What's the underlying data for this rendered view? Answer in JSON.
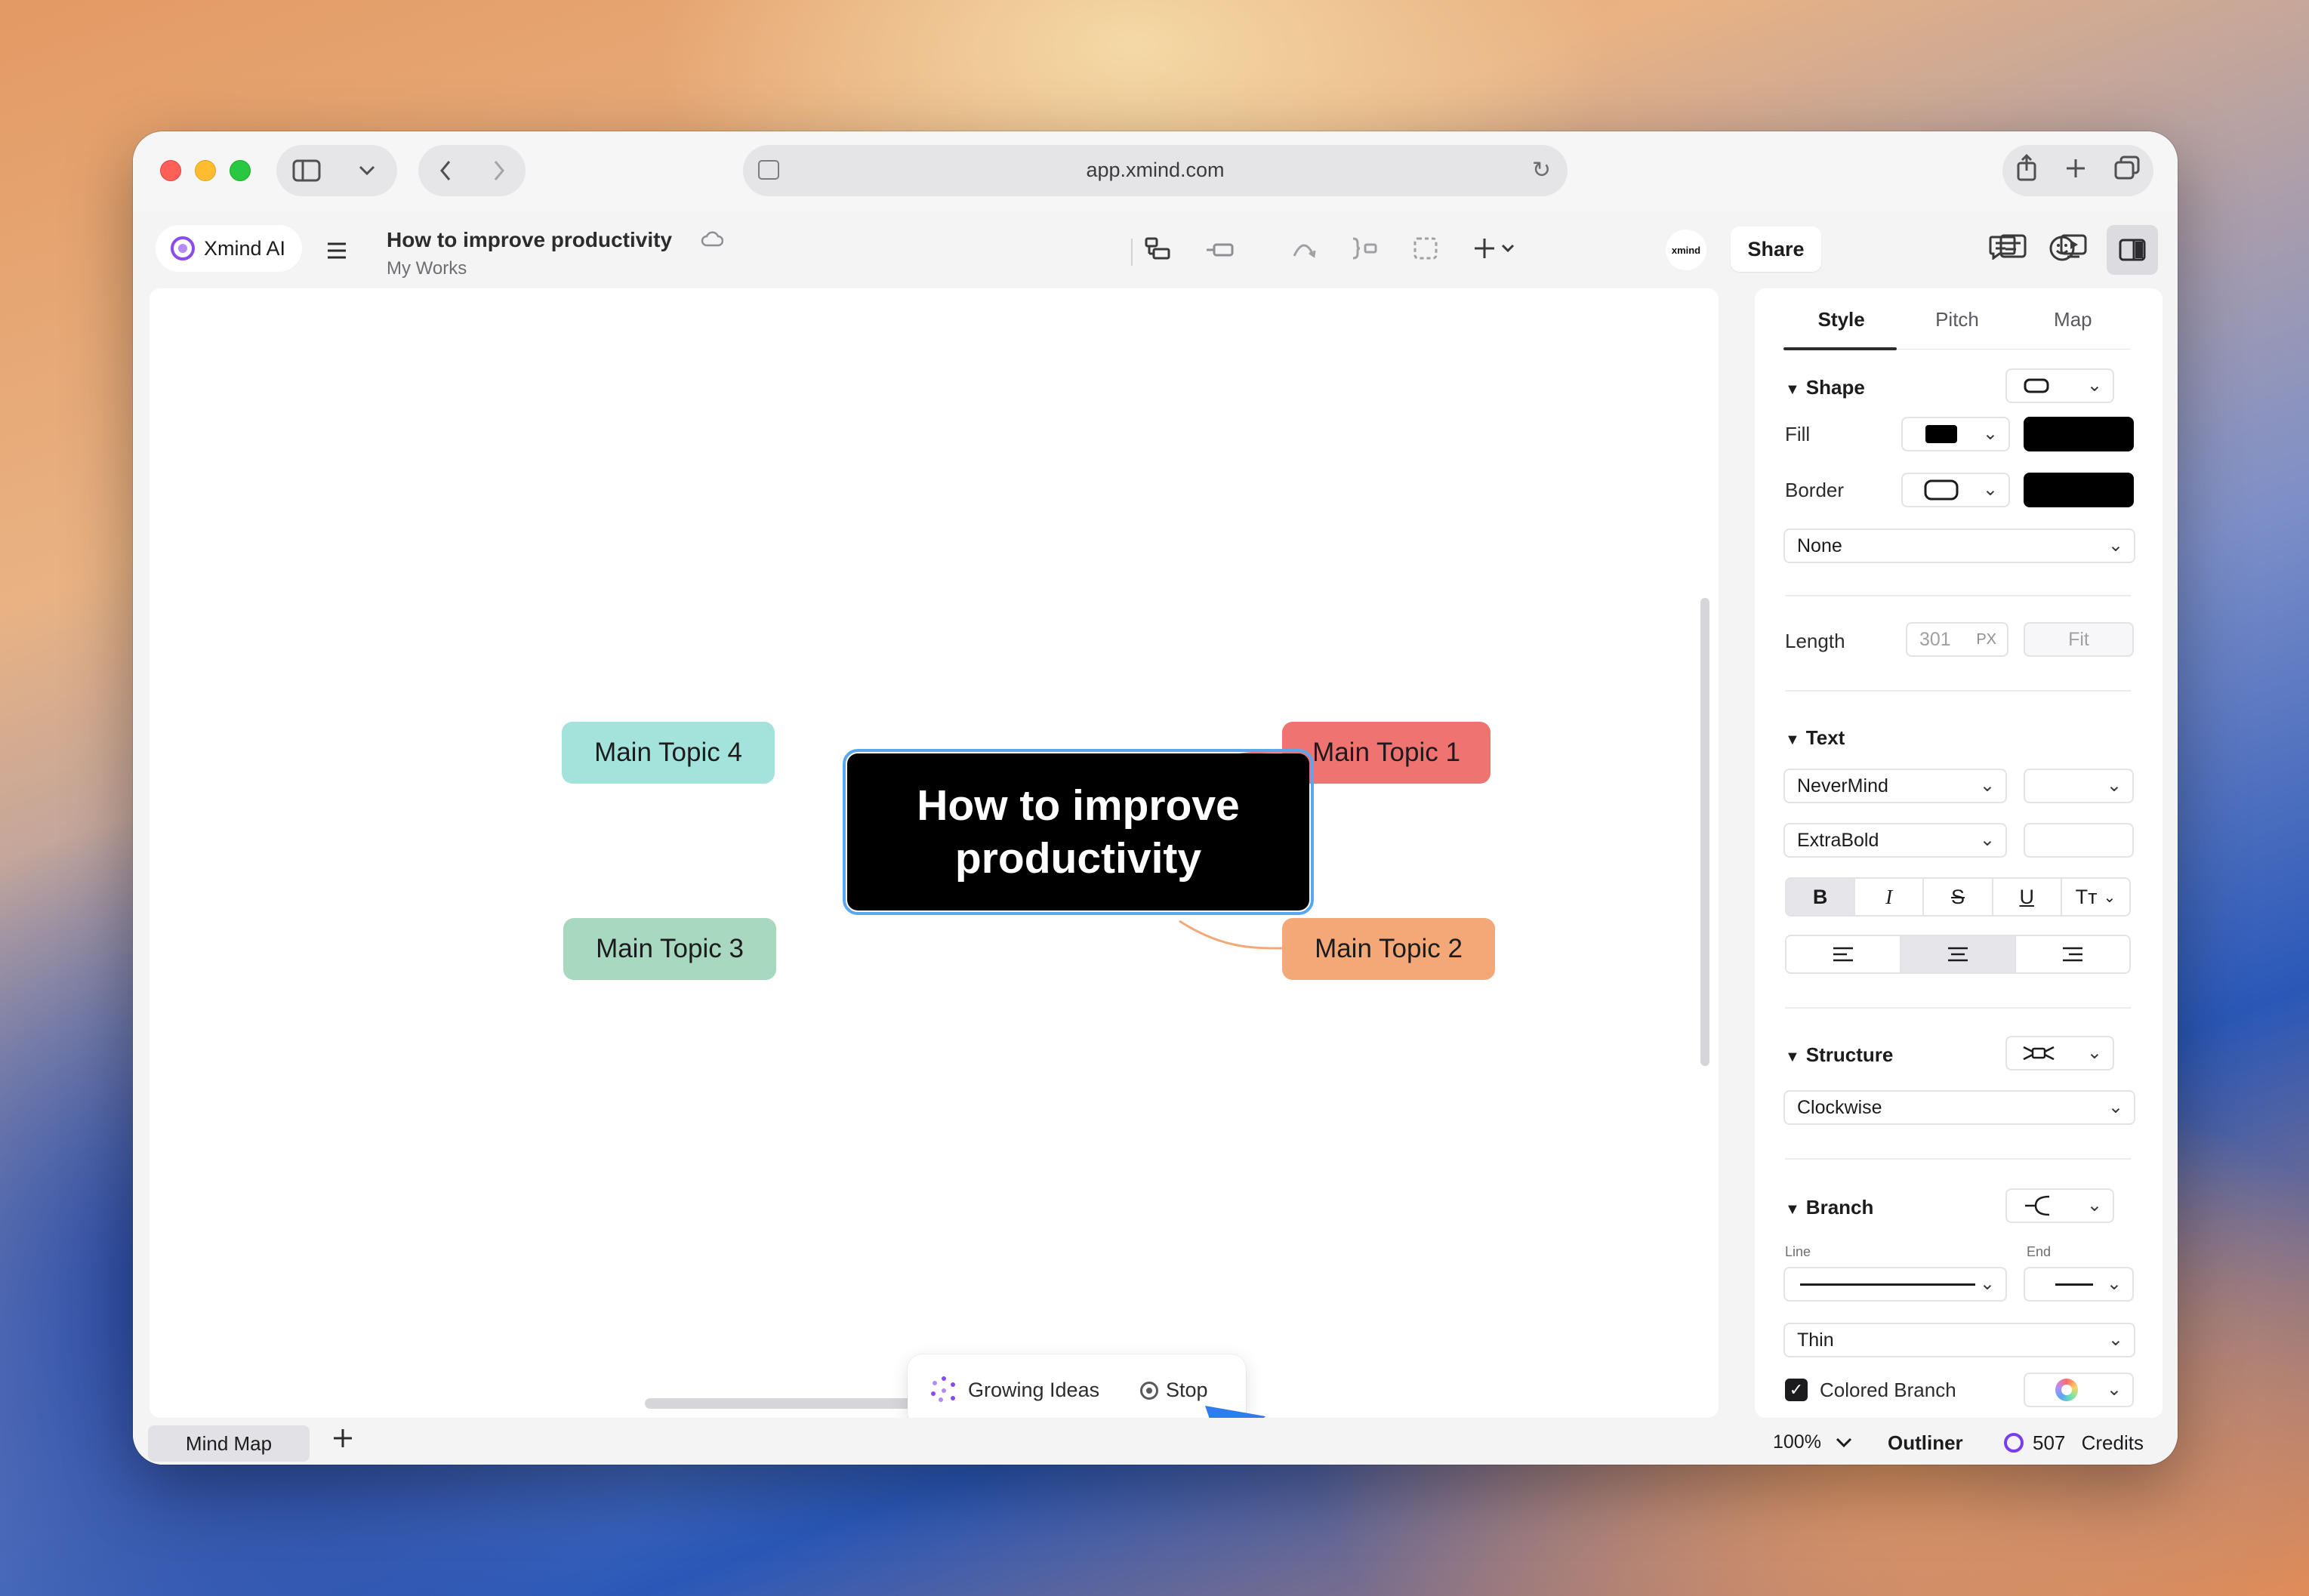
{
  "browser": {
    "url": "app.xmind.com"
  },
  "app": {
    "ai_button_label": "Xmind AI",
    "doc_title": "How to improve productivity",
    "doc_location": "My Works",
    "avatar_label": "xmind",
    "share_label": "Share"
  },
  "mindmap": {
    "central_topic": "How to improve productivity",
    "topics": [
      {
        "label": "Main Topic 1",
        "color": "#ef7371"
      },
      {
        "label": "Main Topic 2",
        "color": "#f4a878"
      },
      {
        "label": "Main Topic 3",
        "color": "#a8d8bf"
      },
      {
        "label": "Main Topic 4",
        "color": "#a3e3dc"
      }
    ],
    "selection_color": "#5aa7f0"
  },
  "ai_popup": {
    "label": "Growing Ideas",
    "stop_label": "Stop"
  },
  "panel": {
    "tabs": [
      "Style",
      "Pitch",
      "Map"
    ],
    "active_tab": "Style",
    "shape": {
      "title": "Shape",
      "fill_label": "Fill",
      "fill_color": "#000000",
      "border_label": "Border",
      "border_color": "#000000",
      "border_style": "None"
    },
    "length": {
      "label": "Length",
      "value": "301",
      "unit": "PX",
      "fit_label": "Fit"
    },
    "text": {
      "title": "Text",
      "font": "NeverMind",
      "weight": "ExtraBold",
      "format_buttons": [
        "B",
        "I",
        "S",
        "U",
        "Tт"
      ]
    },
    "structure": {
      "title": "Structure",
      "value": "Clockwise"
    },
    "branch": {
      "title": "Branch",
      "line_label": "Line",
      "end_label": "End",
      "thickness": "Thin",
      "colored_label": "Colored Branch",
      "colored_checked": true
    }
  },
  "statusbar": {
    "sheet_tab": "Mind Map",
    "zoom": "100%",
    "outliner": "Outliner",
    "credits_value": "507",
    "credits_label": "Credits"
  }
}
